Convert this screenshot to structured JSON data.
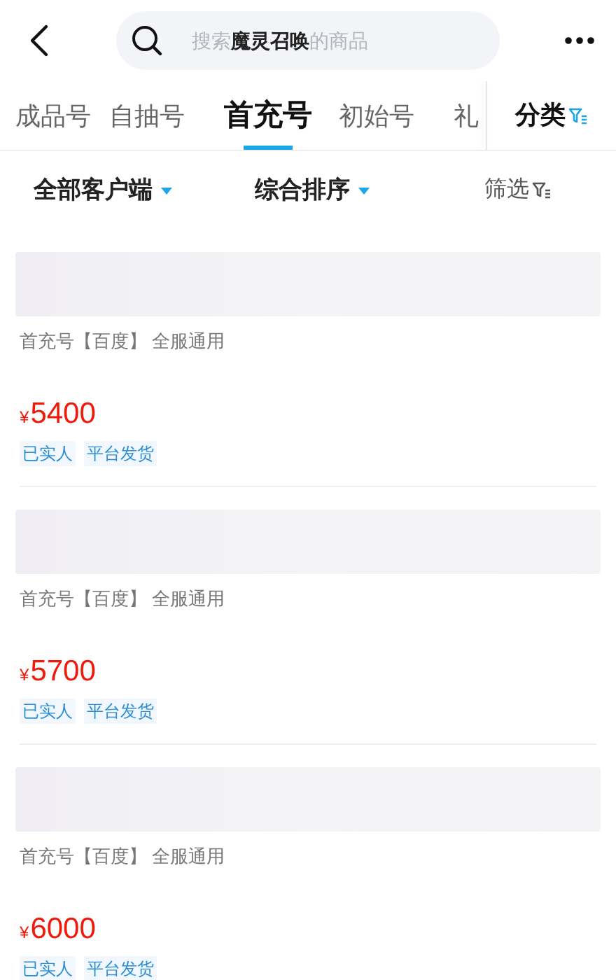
{
  "search": {
    "placeholder": "搜索**魔灵召唤**的商品"
  },
  "tabs": [
    {
      "label": "成品号",
      "selected": false
    },
    {
      "label": "自抽号",
      "selected": false
    },
    {
      "label": "首充号",
      "selected": true
    },
    {
      "label": "初始号",
      "selected": false
    },
    {
      "label": "礼",
      "selected": false
    }
  ],
  "category_button": {
    "label": "分类"
  },
  "filters": [
    {
      "label": "全部客户端",
      "kind": "dropdown"
    },
    {
      "label": "综合排序",
      "kind": "dropdown"
    },
    {
      "label": "筛选",
      "kind": "filter"
    }
  ],
  "listings": [
    {
      "subtitle": "首充号【百度】 全服通用",
      "currency": "¥",
      "price": "5400",
      "tags": [
        "已实人",
        "平台发货"
      ]
    },
    {
      "subtitle": "首充号【百度】 全服通用",
      "currency": "¥",
      "price": "5700",
      "tags": [
        "已实人",
        "平台发货"
      ]
    },
    {
      "subtitle": "首充号【百度】 全服通用",
      "currency": "¥",
      "price": "6000",
      "tags": [
        "已实人",
        "平台发货"
      ]
    }
  ]
}
